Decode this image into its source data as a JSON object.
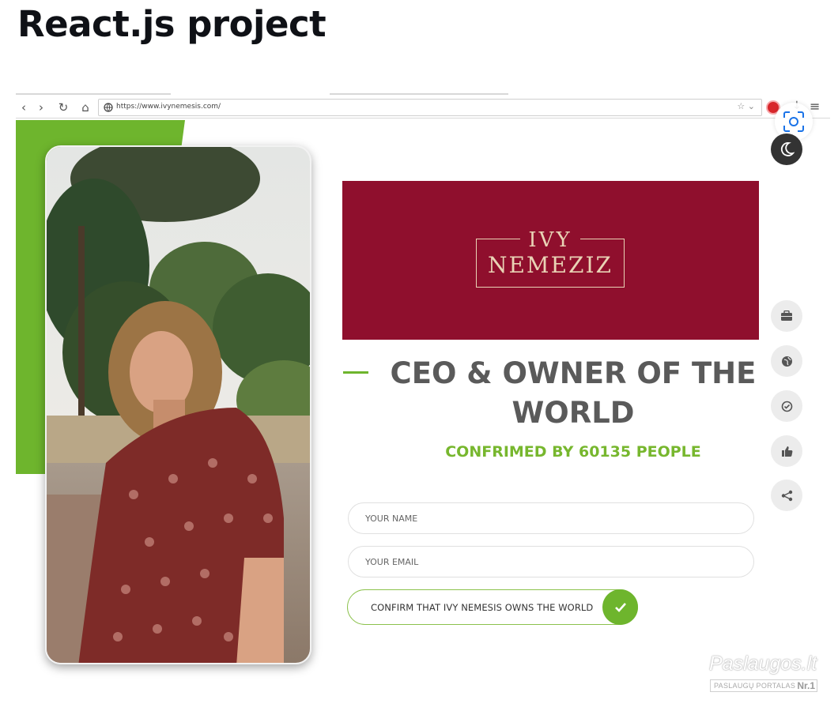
{
  "page_heading": "React.js project",
  "browser": {
    "url": "https://www.ivynemesis.com/",
    "back_icon": "‹",
    "forward_icon": "›",
    "reload_icon": "↻",
    "home_icon": "⌂",
    "globe_icon": "🌐",
    "star_icon": "☆ ⌄",
    "download_icon": "↓",
    "menu_icon": "≡"
  },
  "banner": {
    "logo_top": "IVY",
    "logo_bottom": "NEMEZIZ",
    "color": "#8f0f2d"
  },
  "hero": {
    "headline": "CEO & OWNER OF THE WORLD",
    "confirmed": "CONFRIMED BY 60135 PEOPLE"
  },
  "form": {
    "name_placeholder": "YOUR NAME",
    "email_placeholder": "YOUR EMAIL",
    "confirm_label": "CONFIRM THAT IVY NEMESIS OWNS THE WORLD"
  },
  "side_buttons": [
    "briefcase-icon",
    "globe-icon",
    "check-circle-icon",
    "thumbs-up-icon",
    "share-icon"
  ],
  "colors": {
    "accent_green": "#6eb52d",
    "banner_red": "#8f0f2d",
    "headline_gray": "#5a5a5a"
  },
  "watermark": {
    "brand": "Paslaugos.lt",
    "sub": "PASLAUGŲ PORTALAS",
    "badge": "Nr.1"
  }
}
